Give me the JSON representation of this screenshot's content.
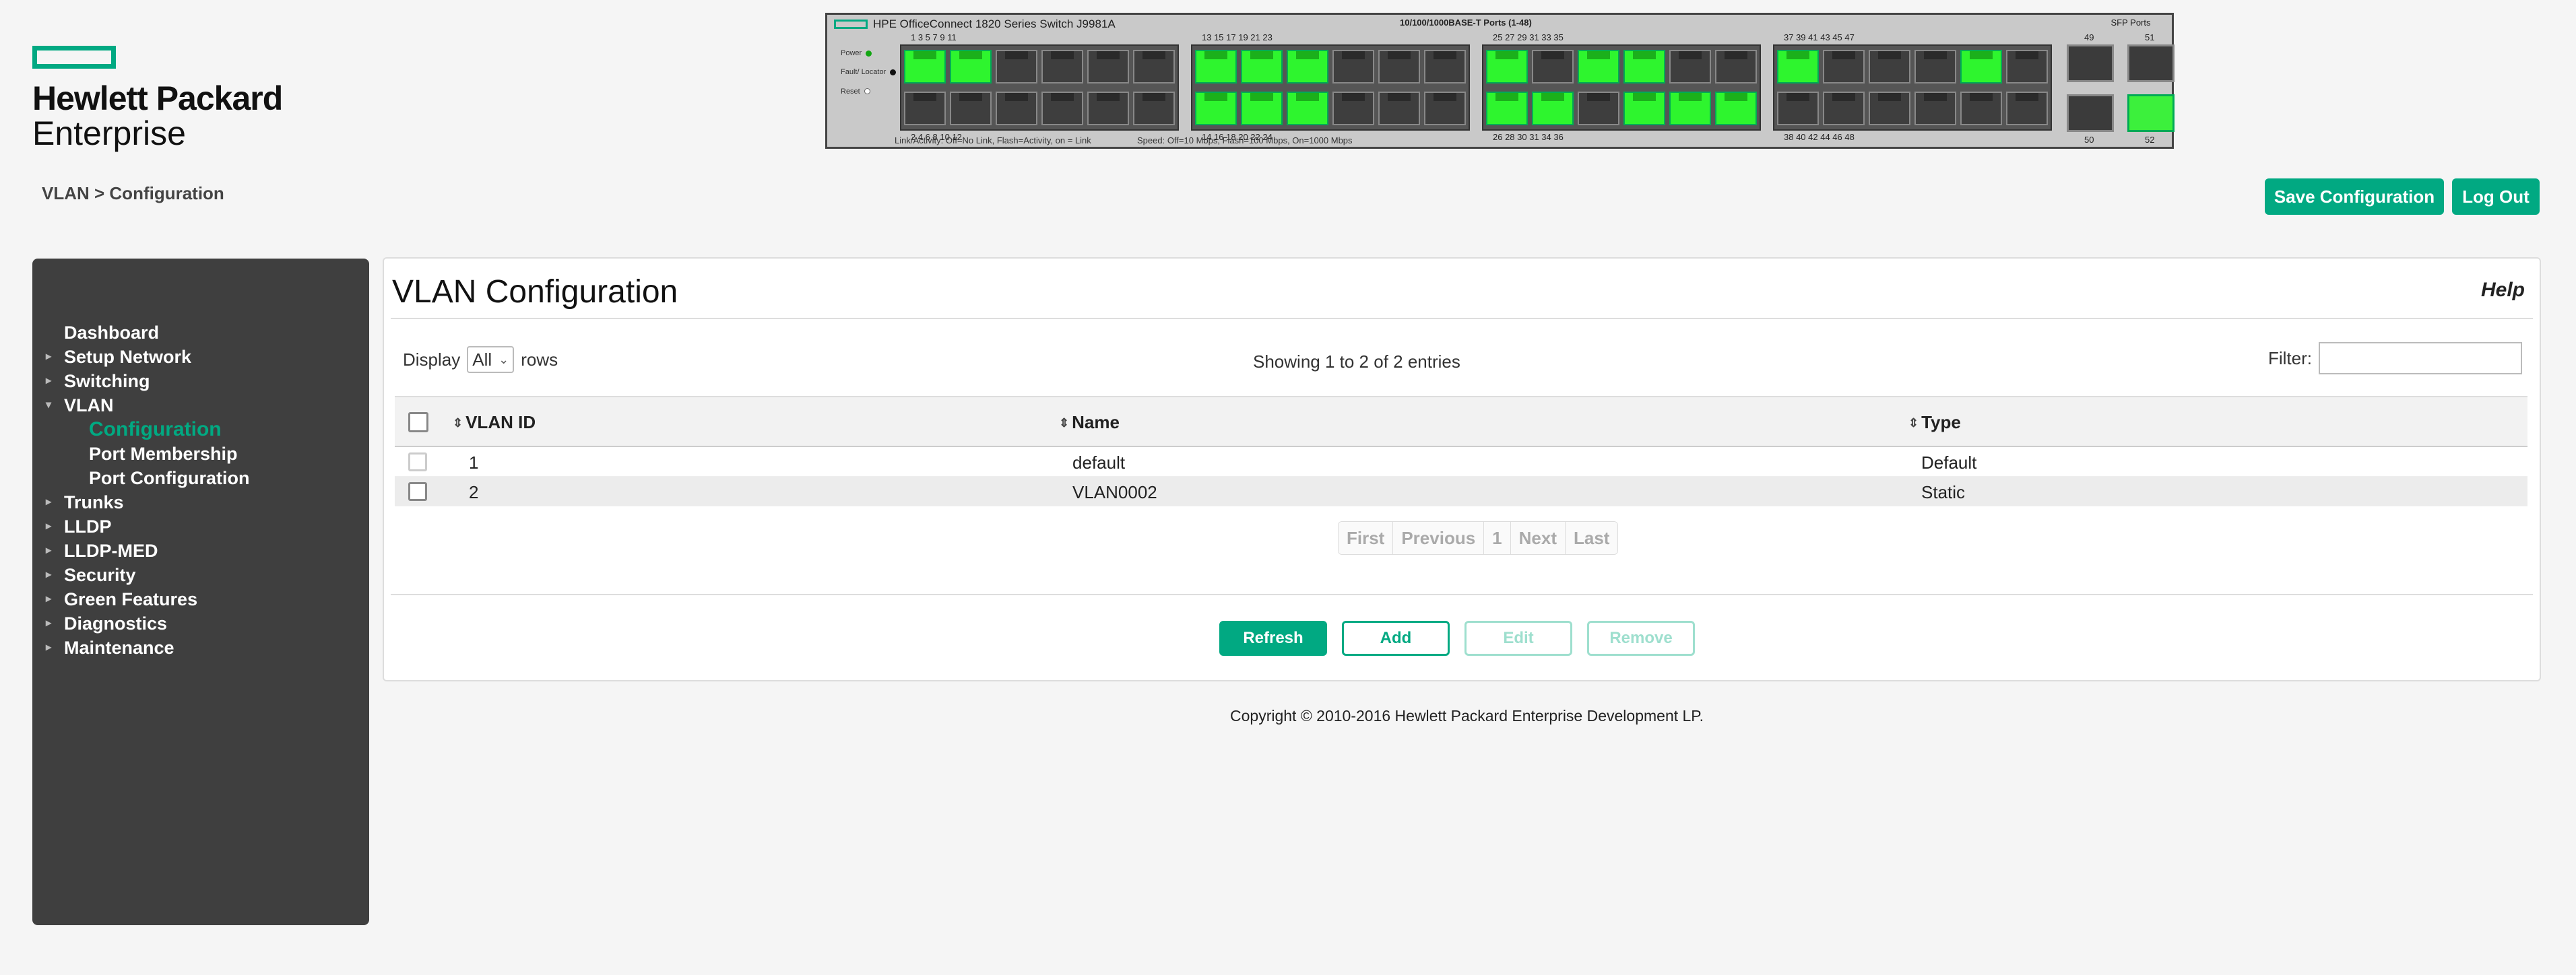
{
  "logo": {
    "line1": "Hewlett Packard",
    "line2": "Enterprise"
  },
  "switch_panel": {
    "model": "HPE OfficeConnect 1820 Series Switch J9981A",
    "ports_title": "10/100/1000BASE-T Ports (1-48)",
    "sfp_title": "SFP Ports",
    "led_labels": [
      "Power",
      "Fault/ Locator",
      "Reset"
    ],
    "legend1": "Link/Activity: Off=No Link, Flash=Activity, on = Link",
    "legend2": "Speed: Off=10 Mbps, Flash=100 Mbps, On=1000 Mbps",
    "top_numbers": [
      [
        "1",
        "3",
        "5",
        "7",
        "9",
        "11"
      ],
      [
        "13",
        "15",
        "17",
        "19",
        "21",
        "23"
      ],
      [
        "25",
        "27",
        "29",
        "31",
        "33",
        "35"
      ],
      [
        "37",
        "39",
        "41",
        "43",
        "45",
        "47"
      ]
    ],
    "bottom_numbers": [
      [
        "2",
        "4",
        "6",
        "8",
        "10",
        "12"
      ],
      [
        "14",
        "16",
        "18",
        "20",
        "22",
        "24"
      ],
      [
        "26",
        "28",
        "30",
        "31",
        "34",
        "36"
      ],
      [
        "38",
        "40",
        "42",
        "44",
        "46",
        "48"
      ]
    ],
    "sfp_numbers": [
      "49",
      "51",
      "50",
      "52"
    ],
    "active_ports": [
      1,
      3,
      13,
      15,
      17,
      25,
      29,
      31,
      37,
      45,
      14,
      16,
      18,
      26,
      28,
      34,
      36,
      52
    ],
    "active_color": "#2ef52e"
  },
  "breadcrumb": "VLAN > Configuration",
  "header_buttons": {
    "save": "Save Configuration",
    "logout": "Log Out"
  },
  "sidebar": {
    "items": [
      {
        "label": "Dashboard",
        "arrow": ""
      },
      {
        "label": "Setup Network",
        "arrow": "▸"
      },
      {
        "label": "Switching",
        "arrow": "▸"
      },
      {
        "label": "VLAN",
        "arrow": "▾"
      },
      {
        "label": "Trunks",
        "arrow": "▸"
      },
      {
        "label": "LLDP",
        "arrow": "▸"
      },
      {
        "label": "LLDP-MED",
        "arrow": "▸"
      },
      {
        "label": "Security",
        "arrow": "▸"
      },
      {
        "label": "Green Features",
        "arrow": "▸"
      },
      {
        "label": "Diagnostics",
        "arrow": "▸"
      },
      {
        "label": "Maintenance",
        "arrow": "▸"
      }
    ],
    "vlan_sub": [
      "Configuration",
      "Port Membership",
      "Port Configuration"
    ]
  },
  "panel": {
    "title": "VLAN Configuration",
    "help": "Help",
    "display_label": "Display",
    "display_value": "All",
    "rows_label": "rows",
    "showing": "Showing 1 to 2 of 2 entries",
    "filter_label": "Filter:",
    "filter_value": ""
  },
  "table": {
    "columns": [
      "VLAN ID",
      "Name",
      "Type"
    ],
    "rows": [
      {
        "id": "1",
        "name": "default",
        "type": "Default"
      },
      {
        "id": "2",
        "name": "VLAN0002",
        "type": "Static"
      }
    ]
  },
  "pager": [
    "First",
    "Previous",
    "1",
    "Next",
    "Last"
  ],
  "actions": {
    "refresh": "Refresh",
    "add": "Add",
    "edit": "Edit",
    "remove": "Remove"
  },
  "copyright": "Copyright © 2010-2016 Hewlett Packard Enterprise Development LP.",
  "colors": {
    "accent": "#01a982",
    "sidebar_bg": "#3f3f3f",
    "page_bg": "#f5f5f5"
  }
}
